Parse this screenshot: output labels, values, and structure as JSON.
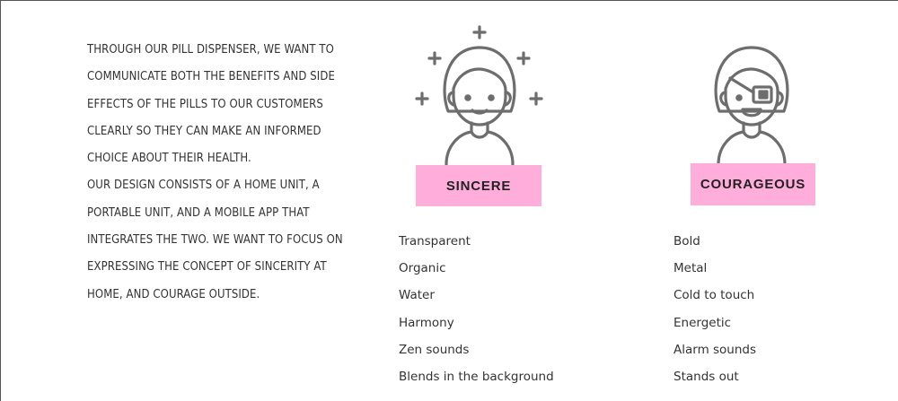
{
  "intro": {
    "paragraph1": "THROUGH OUR PILL DISPENSER, WE WANT TO COMMUNICATE BOTH THE BENEFITS AND SIDE EFFECTS OF THE PILLS TO OUR CUSTOMERS CLEARLY SO THEY CAN MAKE AN INFORMED CHOICE ABOUT THEIR HEALTH.",
    "paragraph2": "OUR DESIGN CONSISTS OF A HOME UNIT, A PORTABLE UNIT, AND A MOBILE APP THAT INTEGRATES THE TWO. WE WANT TO FOCUS ON EXPRESSING THE CONCEPT OF SINCERITY AT HOME, AND COURAGE OUTSIDE."
  },
  "personas": [
    {
      "label": "SINCERE",
      "icon": "sincere-person-icon",
      "traits": [
        "Transparent",
        "Organic",
        "Water",
        "Harmony",
        "Zen sounds",
        "Blends in the background"
      ]
    },
    {
      "label": "COURAGEOUS",
      "icon": "courageous-person-icon",
      "traits": [
        "Bold",
        "Metal",
        "Cold to touch",
        "Energetic",
        "Alarm sounds",
        "Stands out"
      ]
    }
  ],
  "colors": {
    "label_background": "#ffaedb",
    "icon_stroke": "#6d6d6d",
    "text": "#333333"
  }
}
